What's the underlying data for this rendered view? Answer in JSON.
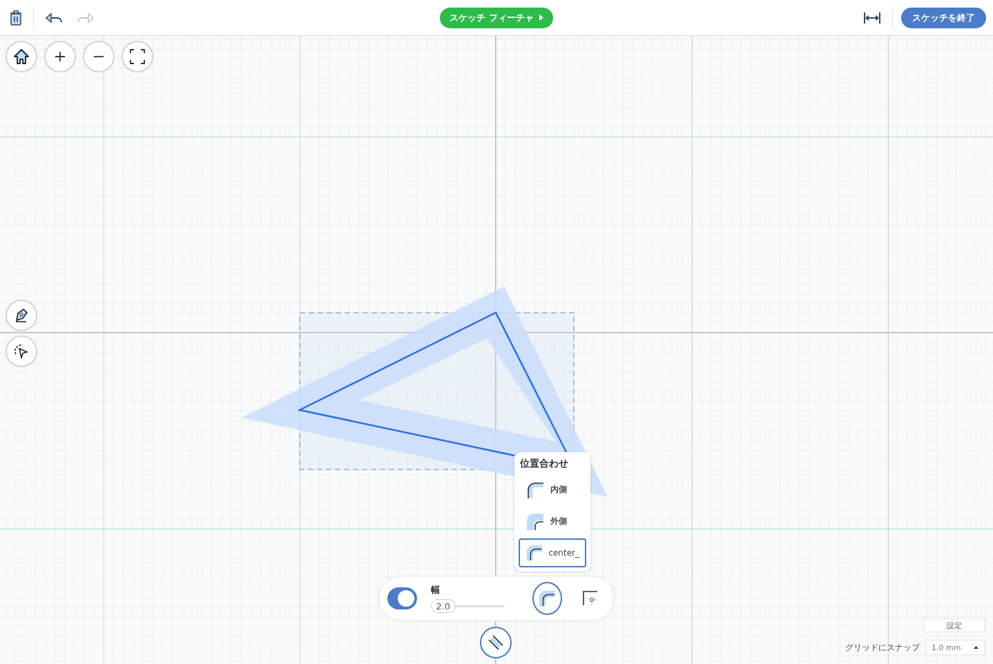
{
  "toolbar": {
    "feature_button": {
      "label": "スケッチ フィーチャ"
    },
    "finish_button": {
      "label": "スケッチを終了"
    },
    "redo_disabled": true
  },
  "alignment_popup": {
    "title": "位置合わせ",
    "options": [
      {
        "kind": "inside",
        "label": "内側",
        "selected": false
      },
      {
        "kind": "outside",
        "label": "外側",
        "selected": false
      },
      {
        "kind": "center",
        "label": "center_",
        "selected": true
      }
    ]
  },
  "offset_bar": {
    "toggle_on": true,
    "width_label": "幅",
    "width_value": "2.0",
    "level": 0,
    "modes": [
      {
        "kind": "round",
        "selected": true
      },
      {
        "kind": "corner",
        "selected": false
      }
    ]
  },
  "settings": {
    "button": "設定",
    "snap_label": "グリッドにスナップ",
    "snap_value": "1.0 mm"
  }
}
